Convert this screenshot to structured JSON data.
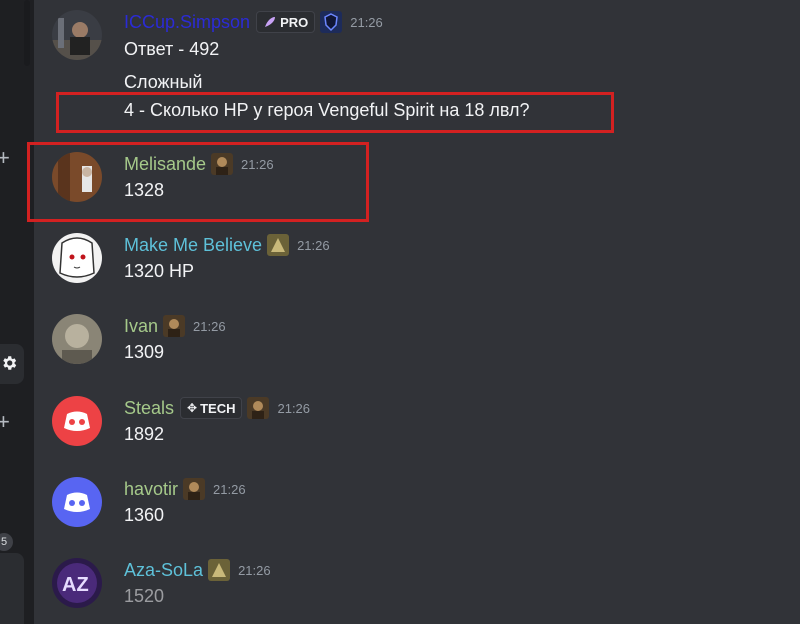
{
  "rail": {
    "unread_count": "5"
  },
  "messages": [
    {
      "username": "ICCup.Simpson",
      "name_color": "#2b2bd6",
      "badge": "PRO",
      "timestamp": "21:26",
      "lines": [
        "Ответ - 492",
        "Сложный",
        "4 -  Сколько HP у героя Vengeful Spirit на 18 лвл?"
      ]
    },
    {
      "username": "Melisande",
      "name_color": "#a5c98a",
      "timestamp": "21:26",
      "lines": [
        "1328"
      ]
    },
    {
      "username": "Make Me Believe",
      "name_color": "#5ec1d9",
      "timestamp": "21:26",
      "lines": [
        "1320 HP"
      ]
    },
    {
      "username": "Ivan",
      "name_color": "#a5c98a",
      "timestamp": "21:26",
      "lines": [
        "1309"
      ]
    },
    {
      "username": "Steals",
      "name_color": "#a5c98a",
      "badge": "TECH",
      "timestamp": "21:26",
      "lines": [
        "1892"
      ]
    },
    {
      "username": "havotir",
      "name_color": "#a5c98a",
      "timestamp": "21:26",
      "lines": [
        "1360"
      ]
    },
    {
      "username": "Aza-SoLa",
      "name_color": "#5ec1d9",
      "timestamp": "21:26",
      "lines": [
        "1520"
      ]
    }
  ]
}
